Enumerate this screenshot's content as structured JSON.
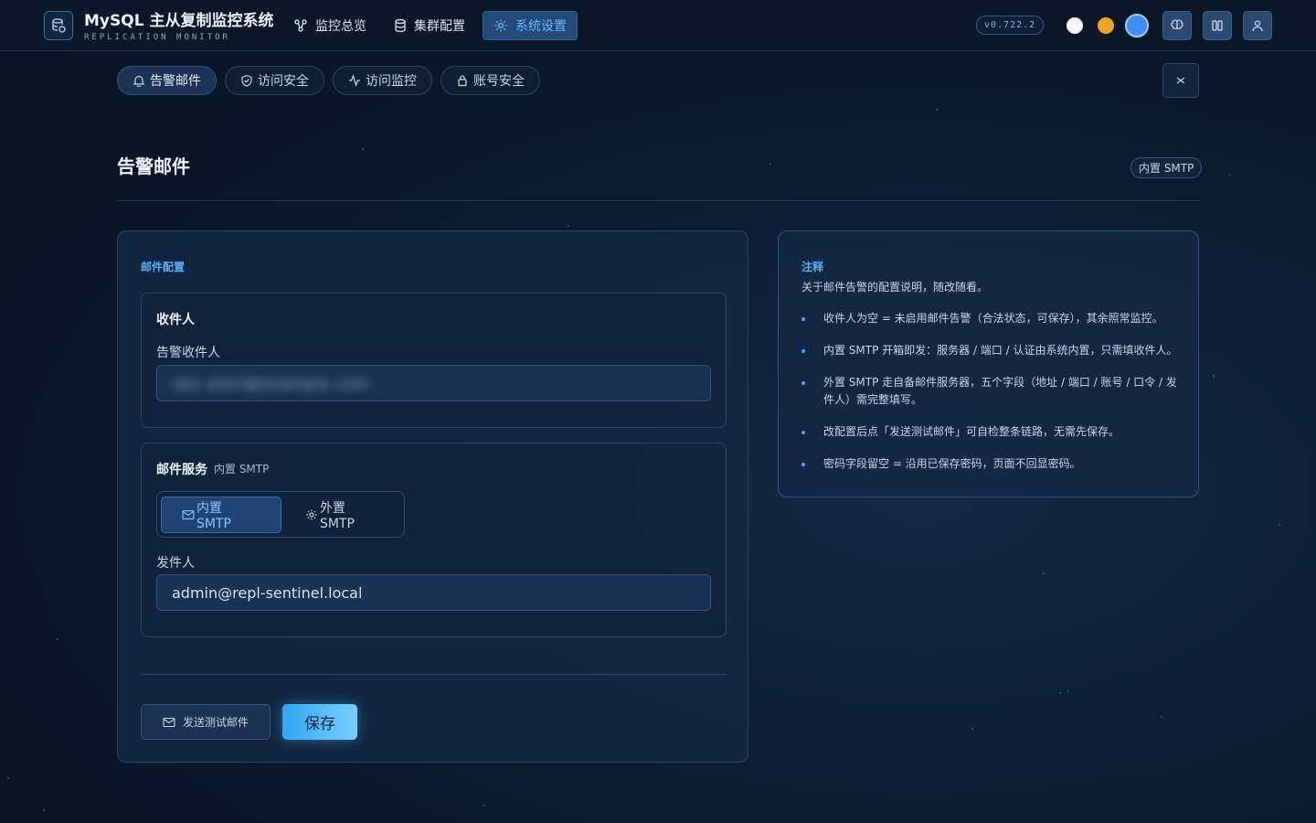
{
  "app": {
    "title": "MySQL 主从复制监控系统",
    "subtitle": "REPLICATION MONITOR",
    "version": "v0.722.2"
  },
  "nav": {
    "items": [
      {
        "label": "监控总览",
        "icon": "cluster-icon",
        "active": false
      },
      {
        "label": "集群配置",
        "icon": "database-icon",
        "active": false
      },
      {
        "label": "系统设置",
        "icon": "gear-icon",
        "active": true
      }
    ]
  },
  "theme_dots": {
    "colors": [
      "#f4f6f8",
      "#f2a324",
      "#3e8ff0"
    ]
  },
  "subtabs": [
    {
      "label": "告警邮件",
      "icon": "bell-icon",
      "active": true
    },
    {
      "label": "访问安全",
      "icon": "shield-icon",
      "active": false
    },
    {
      "label": "访问监控",
      "icon": "activity-icon",
      "active": false
    },
    {
      "label": "账号安全",
      "icon": "lock-icon",
      "active": false
    }
  ],
  "page": {
    "title": "告警邮件",
    "badge": "内置 SMTP"
  },
  "mail_config": {
    "section_label": "邮件配置",
    "recipients": {
      "title": "收件人",
      "field_label": "告警收件人",
      "value": "ops-alert@example.com"
    },
    "service": {
      "title": "邮件服务",
      "tag": "内置 SMTP",
      "options": [
        {
          "label": "内置 SMTP",
          "icon": "mail-icon",
          "active": true
        },
        {
          "label": "外置 SMTP",
          "icon": "gear-icon",
          "active": false
        }
      ],
      "sender_label": "发件人",
      "sender_value": "admin@repl-sentinel.local"
    },
    "buttons": {
      "test": "发送测试邮件",
      "save": "保存"
    }
  },
  "notes": {
    "title": "注释",
    "description": "关于邮件告警的配置说明，随改随看。",
    "items": [
      "收件人为空 = 未启用邮件告警（合法状态，可保存），其余照常监控。",
      "内置 SMTP 开箱即发：服务器 / 端口 / 认证由系统内置，只需填收件人。",
      "外置 SMTP 走自备邮件服务器，五个字段（地址 / 端口 / 账号 / 口令 / 发件人）需完整填写。",
      "改配置后点「发送测试邮件」可自检整条链路，无需先保存。",
      "密码字段留空 = 沿用已保存密码，页面不回显密码。"
    ]
  }
}
